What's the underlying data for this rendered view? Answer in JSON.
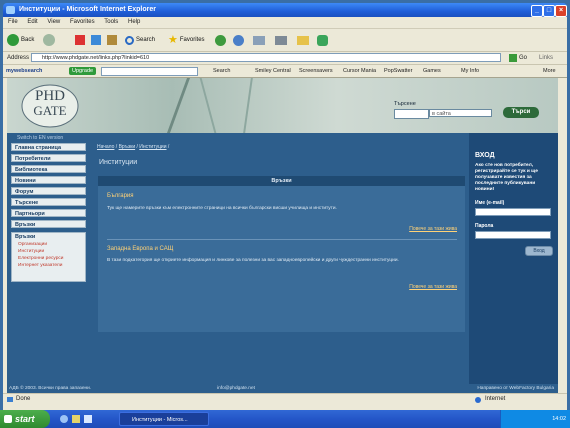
{
  "window": {
    "title": "Институции - Microsoft Internet Explorer"
  },
  "menu": [
    "File",
    "Edit",
    "View",
    "Favorites",
    "Tools",
    "Help"
  ],
  "toolbar": {
    "back": "Back",
    "search": "Search",
    "favorites": "Favorites"
  },
  "address": {
    "label": "Address",
    "url": "http://www.phdgate.net/links.php?linkid=610",
    "go": "Go",
    "links": "Links"
  },
  "linksbar": {
    "brand": "mywebsearch",
    "upgrade": "Upgrade",
    "search": "Search",
    "items": [
      "Smiley Central",
      "Screensavers",
      "Cursor Mania",
      "PopSwatter",
      "Games",
      "My Info"
    ],
    "more": "More"
  },
  "header": {
    "logo_line1": "PHD",
    "logo_line2": "GATE",
    "search_label": "Търсене",
    "search_scope": "в сайта",
    "search_button": "Търси"
  },
  "sidebar": {
    "switch_label": "Switch to EN version",
    "items": [
      "Главна страница",
      "Потребители",
      "Библиотека",
      "Новини",
      "Форум",
      "Търсене",
      "Партньори",
      "Връзки"
    ],
    "submenu_title": "Връзки",
    "submenu": [
      "Организации",
      "Институции",
      "Електронни ресурси",
      "Интернет указатели"
    ]
  },
  "breadcrumb": [
    "Начало",
    "Връзки",
    "Институции"
  ],
  "page_title": "Институции",
  "content": {
    "header": "Връзки",
    "sections": [
      {
        "title": "България",
        "text": "Тук ще намерите връзки към електронните страници на всички български висши училища и институти.",
        "more": "Повече за тази жива"
      },
      {
        "title": "Западна Европа и САЩ",
        "text": "В тази подкатегория ще откриете информация и линкове за полезни за вас западноевропейски и други чуждестранни институции.",
        "more": "Повече за тази жива"
      }
    ]
  },
  "login": {
    "title": "ВХОД",
    "text": "Ако сте нов потребител, регистрирайте се тук и ще получавате известия за последните публикувани новини!",
    "user_label": "Име (e-mail)",
    "pass_label": "Парола",
    "button": "Вход"
  },
  "footer": {
    "left": "АДБ © 2003. Всички права запазени.",
    "email": "info@phdgate.net",
    "right": "Направено от WebFactory Bulgaria"
  },
  "status": {
    "left": "Done",
    "right": "Internet"
  },
  "taskbar": {
    "start": "start",
    "task": "Институции - Micros...",
    "clock": "14:02"
  }
}
